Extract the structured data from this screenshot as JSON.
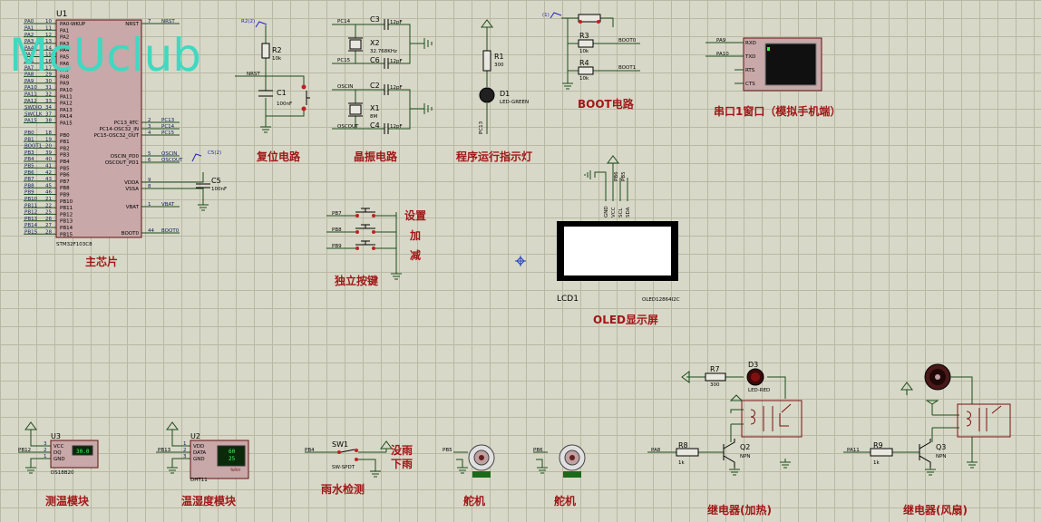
{
  "logo": "McUclub",
  "captions": {
    "mcu": "主芯片",
    "reset": "复位电路",
    "crystal": "晶振电路",
    "led": "程序运行指示灯",
    "boot": "BOOT电路",
    "uart": "串口1窗口（模拟手机端）",
    "keys": "独立按键",
    "key_set": "设置",
    "key_add": "加",
    "key_sub": "减",
    "oled": "OLED显示屏",
    "temp": "测温模块",
    "dht": "温湿度模块",
    "rain": "雨水检测",
    "rain_yes": "没雨",
    "rain_no": "下雨",
    "servo1": "舵机",
    "servo2": "舵机",
    "relay_heat": "继电器(加热)",
    "relay_fan": "继电器(风扇)"
  },
  "mcu": {
    "ref": "U1",
    "part": "STM32F103C8",
    "left_pins": [
      {
        "n": "PA0",
        "num": "10"
      },
      {
        "n": "PA1",
        "num": "11"
      },
      {
        "n": "PA2",
        "num": "12"
      },
      {
        "n": "PA3",
        "num": "13"
      },
      {
        "n": "PA4",
        "num": "14"
      },
      {
        "n": "PA5",
        "num": "15"
      },
      {
        "n": "PA6",
        "num": "16"
      },
      {
        "n": "PA7",
        "num": "17"
      },
      {
        "n": "PA8",
        "num": "29"
      },
      {
        "n": "PA9",
        "num": "30"
      },
      {
        "n": "PA10",
        "num": "31"
      },
      {
        "n": "PA11",
        "num": "32"
      },
      {
        "n": "PA12",
        "num": "33"
      },
      {
        "n": "SWDIO",
        "num": "34"
      },
      {
        "n": "SWCLK",
        "num": "37"
      },
      {
        "n": "PA15",
        "num": "38"
      },
      {
        "n": "PB0",
        "num": "18"
      },
      {
        "n": "PB1",
        "num": "19"
      },
      {
        "n": "BOOT1",
        "num": "20"
      },
      {
        "n": "PB3",
        "num": "39"
      },
      {
        "n": "PB4",
        "num": "40"
      },
      {
        "n": "PB5",
        "num": "41"
      },
      {
        "n": "PB6",
        "num": "42"
      },
      {
        "n": "PB7",
        "num": "43"
      },
      {
        "n": "PB8",
        "num": "45"
      },
      {
        "n": "PB9",
        "num": "46"
      },
      {
        "n": "PB10",
        "num": "21"
      },
      {
        "n": "PB11",
        "num": "22"
      },
      {
        "n": "PB12",
        "num": "25"
      },
      {
        "n": "PB13",
        "num": "26"
      },
      {
        "n": "PB14",
        "num": "27"
      },
      {
        "n": "PB15",
        "num": "28"
      }
    ],
    "inner_left": [
      "PA0-WKUP",
      "PA1",
      "PA2",
      "PA3",
      "PA4",
      "PA5",
      "PA6",
      "PA7",
      "PA8",
      "PA9",
      "PA10",
      "PA11",
      "PA12",
      "PA13",
      "PA14",
      "PA15",
      "PB0",
      "PB1",
      "PB2",
      "PB3",
      "PB4",
      "PB5",
      "PB6",
      "PB7",
      "PB8",
      "PB9",
      "PB10",
      "PB11",
      "PB12",
      "PB13",
      "PB14",
      "PB15"
    ],
    "right_pins": [
      {
        "inner": "NRST",
        "num": "7",
        "net": "NRST"
      },
      {
        "inner": "PC13_RTC",
        "num": "2",
        "net": "PC13"
      },
      {
        "inner": "PC14-OSC32_IN",
        "num": "3",
        "net": "PC14"
      },
      {
        "inner": "PC15-OSC32_OUT",
        "num": "4",
        "net": "PC15"
      },
      {
        "inner": "OSCIN_PD0",
        "num": "5",
        "net": "OSCIN"
      },
      {
        "inner": "OSCOUT_PD1",
        "num": "6",
        "net": "OSCOUT"
      },
      {
        "inner": "VDDA",
        "num": "9",
        "net": ""
      },
      {
        "inner": "VSSA",
        "num": "8",
        "net": ""
      },
      {
        "inner": "VBAT",
        "num": "1",
        "net": "VBAT"
      },
      {
        "inner": "BOOT0",
        "num": "44",
        "net": "BOOT0"
      }
    ],
    "c5": {
      "ref": "C5",
      "val": "100nF",
      "probe": "C5(2)"
    }
  },
  "reset": {
    "r": "R2",
    "rv": "10k",
    "c": "C1",
    "cv": "100nF",
    "net": "NRST",
    "probe": "R2(2)"
  },
  "crystal": {
    "c3": "C3",
    "c6": "C6",
    "c2": "C2",
    "c4": "C4",
    "cv": "12pF",
    "x2": "X2",
    "x2v": "32.768KHz",
    "x1": "X1",
    "x1v": "8M",
    "n1": "PC14",
    "n2": "PC15",
    "n3": "OSCIN",
    "n4": "OSCOUT"
  },
  "led": {
    "r": "R1",
    "rv": "300",
    "d": "D1",
    "dv": "LED-GREEN",
    "net": "PC13"
  },
  "boot": {
    "r3": "R3",
    "r4": "R4",
    "rv": "10k",
    "n0": "BOOT0",
    "n1": "BOOT1",
    "probe": "(1)"
  },
  "uart": {
    "pins": [
      "RXD",
      "TXD",
      "RTS",
      "CTS"
    ],
    "nets": [
      "PA9",
      "PA10"
    ]
  },
  "keys": {
    "nets": [
      "PB7",
      "PB8",
      "PB9"
    ]
  },
  "oled": {
    "ref": "LCD1",
    "part": "OLED12864I2C",
    "pins": [
      "GND",
      "VCC",
      "SCL",
      "SDA"
    ],
    "nets": [
      "PB6",
      "PB5"
    ]
  },
  "u3": {
    "ref": "U3",
    "part": "DS18B20",
    "pins": [
      "VCC",
      "DQ",
      "GND"
    ],
    "pinnums": [
      "3",
      "2",
      "1"
    ],
    "net": "PB12",
    "display": "30.0"
  },
  "u2": {
    "ref": "U2",
    "part": "DHT11",
    "pins": [
      "VDD",
      "DATA",
      "GND"
    ],
    "pinnums": [
      "1",
      "2",
      "3"
    ],
    "net": "PB13",
    "disp1": "60",
    "disp2": "25",
    "rh": "%RH"
  },
  "sw1": {
    "ref": "SW1",
    "part": "SW-SPDT",
    "net": "PB4"
  },
  "servo1": {
    "net": "PB5"
  },
  "servo2": {
    "net": "PB6"
  },
  "relay1": {
    "r7": "R7",
    "r7v": "300",
    "d3": "D3",
    "d3v": "LED-RED",
    "r8": "R8",
    "r8v": "1k",
    "q": "Q2",
    "qv": "NPN",
    "net": "PA8"
  },
  "relay2": {
    "r9": "R9",
    "r9v": "1k",
    "q": "Q3",
    "qv": "NPN",
    "net": "PA11"
  }
}
